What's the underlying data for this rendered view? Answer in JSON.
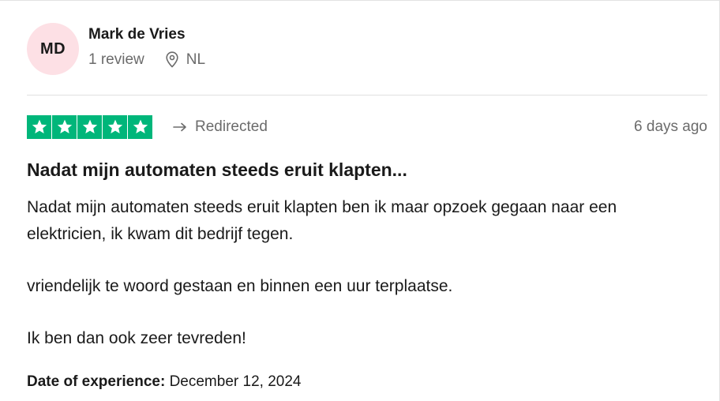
{
  "consumer": {
    "initials": "MD",
    "name": "Mark de Vries",
    "review_count": "1 review",
    "country": "NL"
  },
  "rating": {
    "stars": 5,
    "max_stars": 5,
    "star_color": "#00b67a"
  },
  "redirected_label": "Redirected",
  "date_posted": "6 days ago",
  "review": {
    "title": "Nadat mijn automaten steeds eruit klapten...",
    "paragraphs": [
      "Nadat mijn automaten steeds eruit klapten ben ik maar opzoek gegaan naar een elektricien, ik kwam dit bedrijf tegen.",
      "vriendelijk te woord gestaan en binnen een uur terplaatse.",
      "Ik ben dan ook zeer tevreden!"
    ]
  },
  "experience": {
    "label": "Date of experience:",
    "date": "December 12, 2024"
  },
  "icons": {
    "location": "location-pin-icon",
    "redirect": "redirect-arrow-icon",
    "star": "star-icon"
  }
}
